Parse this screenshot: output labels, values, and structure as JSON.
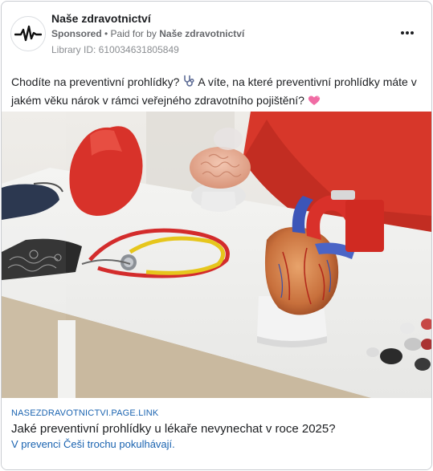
{
  "ad": {
    "page_name": "Naše zdravotnictví",
    "sponsored_label": "Sponsored",
    "paid_for_prefix": " • Paid for by ",
    "paid_for_name": "Naše zdravotnictví",
    "library_id": "Library ID: 610034631805849",
    "more_icon": "more-options-icon",
    "body_part1": "Chodíte na preventivní prohlídky? ",
    "body_part2": " A víte, na které preventivní prohlídky máte v jakém věku nárok v rámci veřejného zdravotního pojištění? ",
    "emoji_1": "stethoscope-emoji",
    "emoji_2": "heart-emoji",
    "avatar_icon": "heartbeat-pulse-icon"
  },
  "link": {
    "domain": "NASEZDRAVOTNICTVI.PAGE.LINK",
    "headline": "Jaké preventivní prohlídky u lékaře nevynechat v roce 2025?",
    "description": "V prevenci Češi trochu pokulhávají."
  },
  "colors": {
    "link_blue": "#1a63b0",
    "muted_gray": "#65676b",
    "card_border": "#c9ccd1"
  }
}
